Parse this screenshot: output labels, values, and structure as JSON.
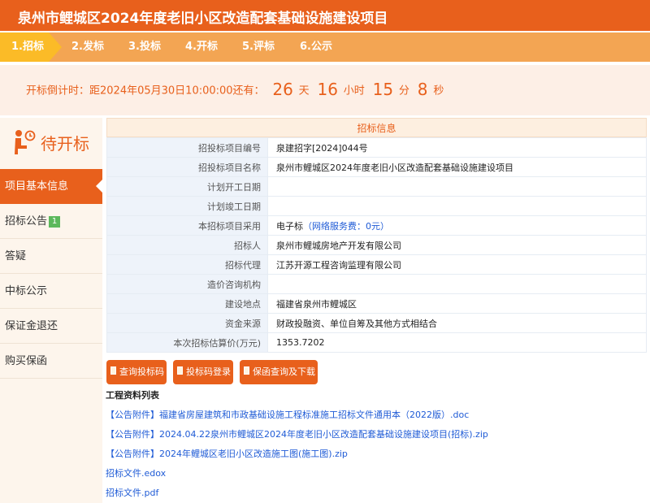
{
  "page": {
    "title": "泉州市鲤城区2024年度老旧小区改造配套基础设施建设项目"
  },
  "steps": [
    {
      "label": "1.招标",
      "active": true
    },
    {
      "label": "2.发标"
    },
    {
      "label": "3.投标"
    },
    {
      "label": "4.开标"
    },
    {
      "label": "5.评标"
    },
    {
      "label": "6.公示"
    }
  ],
  "countdown": {
    "prefix": "开标倒计时：距2024年05月30日10:00:00还有：",
    "days": "26",
    "days_unit": "天",
    "hours": "16",
    "hours_unit": "小时",
    "minutes": "15",
    "minutes_unit": "分",
    "seconds": "8",
    "seconds_unit": "秒"
  },
  "sidebar": {
    "status": "待开标",
    "status_icon": "person-clock-icon",
    "items": [
      {
        "label": "项目基本信息",
        "active": true
      },
      {
        "label": "招标公告",
        "badge": "1"
      },
      {
        "label": "答疑"
      },
      {
        "label": "中标公示"
      },
      {
        "label": "保证金退还"
      },
      {
        "label": "购买保函"
      }
    ]
  },
  "info": {
    "heading": "招标信息",
    "rows": [
      {
        "key": "招投标项目编号",
        "value": "泉建招字[2024]044号"
      },
      {
        "key": "招投标项目名称",
        "value": "泉州市鲤城区2024年度老旧小区改造配套基础设施建设项目"
      },
      {
        "key": "计划开工日期",
        "value": ""
      },
      {
        "key": "计划竣工日期",
        "value": ""
      },
      {
        "key": "本招标项目采用",
        "value": "电子标",
        "extra": "（网络服务费：0元）"
      },
      {
        "key": "招标人",
        "value": "泉州市鲤城房地产开发有限公司"
      },
      {
        "key": "招标代理",
        "value": "江苏开源工程咨询监理有限公司"
      },
      {
        "key": "造价咨询机构",
        "value": ""
      },
      {
        "key": "建设地点",
        "value": "福建省泉州市鲤城区"
      },
      {
        "key": "资金来源",
        "value": "财政投融资、单位自筹及其他方式相结合"
      },
      {
        "key": "本次招标估算价(万元)",
        "value": "1353.7202"
      }
    ]
  },
  "buttons": [
    {
      "label": "查询投标码",
      "icon": "document-icon"
    },
    {
      "label": "投标码登录",
      "icon": "document-icon"
    },
    {
      "label": "保函查询及下载",
      "icon": "document-icon"
    }
  ],
  "files": {
    "title": "工程资料列表",
    "items": [
      "【公告附件】福建省房屋建筑和市政基础设施工程标准施工招标文件通用本（2022版）.doc",
      "【公告附件】2024.04.22泉州市鲤城区2024年度老旧小区改造配套基础设施建设项目(招标).zip",
      "【公告附件】2024年鲤城区老旧小区改造施工图(施工图).zip",
      "招标文件.edox",
      "招标文件.pdf"
    ]
  },
  "colors": {
    "brand": "#e8601c",
    "step_bar": "#f3a553",
    "step_active": "#fbbb27",
    "link": "#1f5bd6"
  }
}
